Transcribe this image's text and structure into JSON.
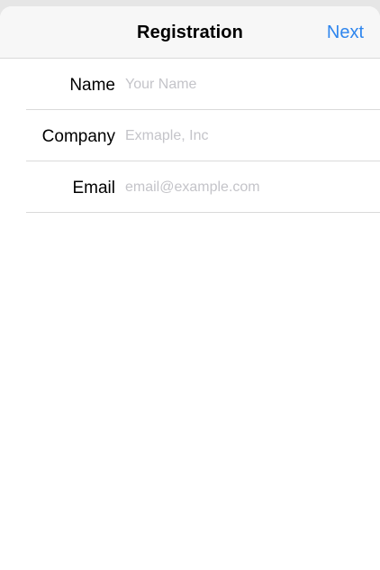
{
  "navbar": {
    "title": "Registration",
    "next_label": "Next",
    "accent_color": "#2f86ee"
  },
  "form": {
    "fields": [
      {
        "label": "Name",
        "value": "",
        "placeholder": "Your Name"
      },
      {
        "label": "Company",
        "value": "",
        "placeholder": "Exmaple, Inc"
      },
      {
        "label": "Email",
        "value": "",
        "placeholder": "email@example.com"
      }
    ]
  }
}
